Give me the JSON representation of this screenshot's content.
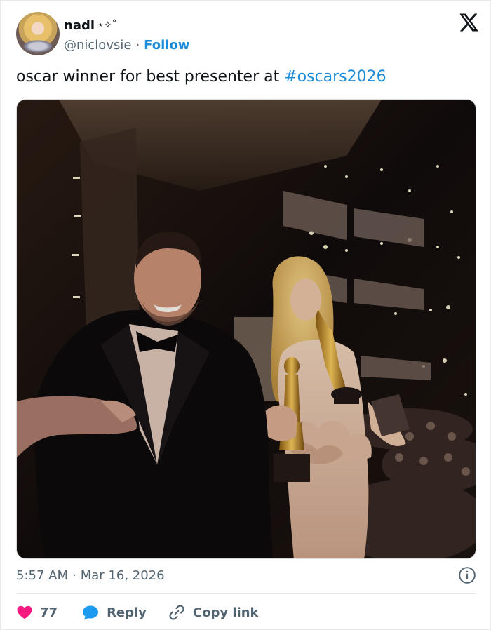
{
  "author": {
    "display_name": "nadi",
    "name_decoration": "⋆✧˚",
    "handle": "@niclovsie",
    "separator": "·",
    "follow_label": "Follow"
  },
  "tweet": {
    "text": "oscar winner for best presenter at ",
    "hashtag": "#oscars2026",
    "time": "5:57 AM",
    "date_separator": "·",
    "date": "Mar 16, 2026"
  },
  "actions": {
    "like_count": "77",
    "reply_label": "Reply",
    "copy_link_label": "Copy link"
  },
  "colors": {
    "link_blue": "#1d8cd8",
    "like_red": "#f91880",
    "reply_blue": "#1d9bf0",
    "muted_text": "#536471"
  },
  "icons": [
    "x-logo-icon",
    "info-icon",
    "heart-icon",
    "reply-bubble-icon",
    "link-icon"
  ]
}
